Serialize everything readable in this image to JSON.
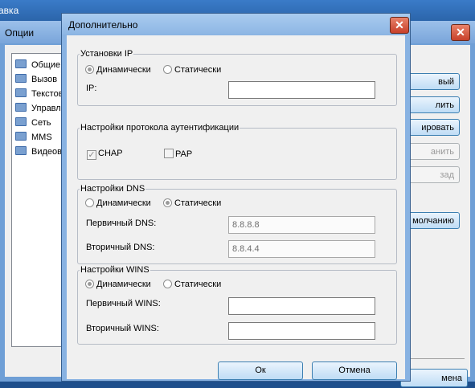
{
  "app": {
    "title_fragment": "авка"
  },
  "options": {
    "title": "Опции",
    "tree": [
      "Общие",
      "Вызов",
      "Текстов",
      "Управле",
      "Сеть",
      "MMS",
      "Видеовы"
    ],
    "buttons": [
      "вый",
      "лить",
      "ировать",
      "анить",
      "зад",
      "молчанию"
    ],
    "cancel": "мена"
  },
  "dialog": {
    "title": "Дополнительно",
    "ip": {
      "legend": "Установки IP",
      "dynamic": "Динамически",
      "static": "Статически",
      "ip_label": "IP:",
      "ip_value": ""
    },
    "auth": {
      "legend": "Настройки протокола аутентификации",
      "chap": "CHAP",
      "pap": "PAP"
    },
    "dns": {
      "legend": "Настройки DNS",
      "dynamic": "Динамически",
      "static": "Статически",
      "primary_label": "Первичный DNS:",
      "primary_value": "8.8.8.8",
      "secondary_label": "Вторичный DNS:",
      "secondary_value": "8.8.4.4"
    },
    "wins": {
      "legend": "Настройки WINS",
      "dynamic": "Динамически",
      "static": "Статически",
      "primary_label": "Первичный WINS:",
      "primary_value": "",
      "secondary_label": "Вторичный WINS:",
      "secondary_value": ""
    },
    "ok": "Ок",
    "cancel": "Отмена"
  },
  "icons": {
    "close": "close-icon",
    "folder": "folder-icon"
  },
  "colors": {
    "titlebar": "#79a5da",
    "close_button": "#c8402a",
    "button": "#bfdcf5"
  }
}
